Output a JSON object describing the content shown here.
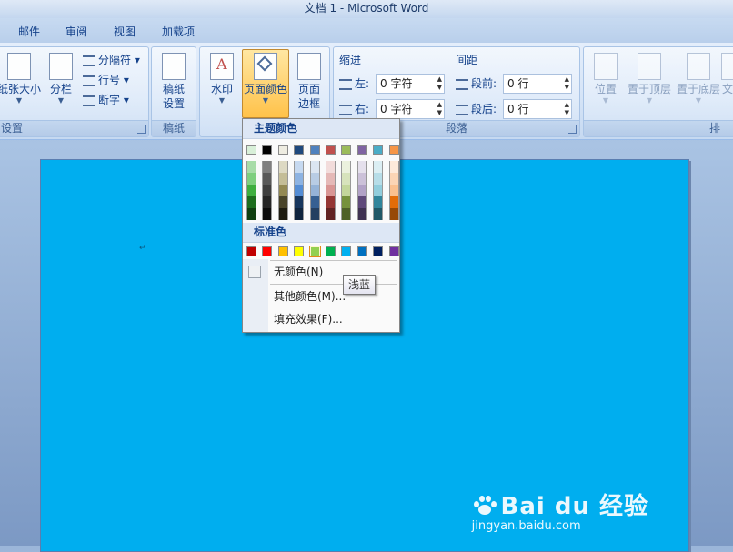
{
  "window": {
    "title": "文档 1 - Microsoft Word"
  },
  "tabs": [
    "邮件",
    "审阅",
    "视图",
    "加载项"
  ],
  "ribbon": {
    "page_setup": {
      "paper_size": "纸张大小",
      "columns": "分栏",
      "breaks": "分隔符",
      "line_numbers": "行号",
      "hyphenation": "断字",
      "group_label": "设置"
    },
    "manuscript": {
      "btn_line1": "稿纸",
      "btn_line2": "设置",
      "group_label": "稿纸"
    },
    "page_background": {
      "watermark": "水印",
      "page_color": "页面颜色",
      "page_borders_line1": "页面",
      "page_borders_line2": "边框"
    },
    "paragraph": {
      "indent_label": "缩进",
      "left_label": "左:",
      "left_value": "0 字符",
      "right_label": "右:",
      "right_value": "0 字符",
      "spacing_label": "间距",
      "before_label": "段前:",
      "before_value": "0 行",
      "after_label": "段后:",
      "after_value": "0 行",
      "group_label": "段落"
    },
    "arrange": {
      "position": "位置",
      "bring_front": "置于顶层",
      "send_back": "置于底层",
      "text_wrap": "文",
      "group_label": "排"
    }
  },
  "dropdown": {
    "theme_header": "主题颜色",
    "standard_header": "标准色",
    "no_color": "无颜色(N)",
    "more_colors": "其他颜色(M)...",
    "fill_effects": "填充效果(F)...",
    "tooltip": "浅蓝",
    "theme_base": [
      "#d9f0d9",
      "#000000",
      "#eeece1",
      "#1f497d",
      "#4f81bd",
      "#c0504d",
      "#9bbb59",
      "#8064a2",
      "#4bacc6",
      "#f79646"
    ],
    "theme_shades": [
      [
        "#a8dca8",
        "#7fcf7f",
        "#3fae3f",
        "#1d6d1d",
        "#0f3f0f"
      ],
      [
        "#7f7f7f",
        "#595959",
        "#3f3f3f",
        "#262626",
        "#0d0d0d"
      ],
      [
        "#ddd9c3",
        "#c4bd97",
        "#938953",
        "#494429",
        "#1d1b10"
      ],
      [
        "#c6d9f0",
        "#8db3e2",
        "#548dd4",
        "#17365d",
        "#0f243e"
      ],
      [
        "#dbe5f1",
        "#b8cce4",
        "#95b3d7",
        "#366092",
        "#244061"
      ],
      [
        "#f2dcdb",
        "#e5b9b7",
        "#d99694",
        "#953734",
        "#632423"
      ],
      [
        "#ebf1dd",
        "#d7e3bc",
        "#c3d69b",
        "#76923c",
        "#4f6128"
      ],
      [
        "#e5e0ec",
        "#ccc1d9",
        "#b2a2c7",
        "#5f497a",
        "#3f3151"
      ],
      [
        "#dbeef3",
        "#b7dde8",
        "#92cddc",
        "#31859b",
        "#205867"
      ],
      [
        "#fdeada",
        "#fbd5b5",
        "#fac08f",
        "#e36c09",
        "#974806"
      ]
    ],
    "standard": [
      "#c00000",
      "#ff0000",
      "#ffc000",
      "#ffff00",
      "#92d050",
      "#00b050",
      "#00b0f0",
      "#0070c0",
      "#002060",
      "#7030a0"
    ]
  },
  "document": {
    "background_color": "#00aeef"
  },
  "watermark": {
    "brand": "Bai du 经验",
    "sub": "jingyan.baidu.com"
  }
}
